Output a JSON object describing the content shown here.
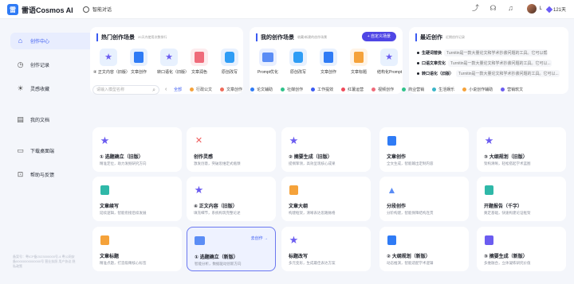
{
  "app": {
    "name": "雷语Cosmos AI",
    "logo_glyph": "雷"
  },
  "topbar": {
    "smart_chat": "智能对话",
    "user_initial": "L",
    "credits": "121天"
  },
  "sidebar": {
    "items": [
      {
        "label": "创作中心",
        "icon": "home-icon"
      },
      {
        "label": "创作记录",
        "icon": "clock-icon"
      },
      {
        "label": "灵感收藏",
        "icon": "bulb-icon"
      },
      {
        "label": "我的文档",
        "icon": "doc-icon"
      },
      {
        "label": "下载桌面端",
        "icon": "monitor-icon"
      },
      {
        "label": "帮助与反馈",
        "icon": "help-icon"
      }
    ],
    "footnote": "备案号：粤ICP备2023000000号-4 粤公网安备00000000000000号 营业执照 用户协议 隐私政策"
  },
  "hot": {
    "title": "热门创作场景",
    "subtitle": "20天内使用次数排行",
    "tiles": [
      {
        "label": "④ 正文内容（旧版）",
        "color": "#6b5cf0"
      },
      {
        "label": "文章创作",
        "color": "#2f7bf5"
      },
      {
        "label": "转口语化（旧版）",
        "color": "#6b5cf0"
      },
      {
        "label": "文章润色",
        "color": "#ef6b7a"
      },
      {
        "label": "原创改写",
        "color": "#2f9df5"
      }
    ]
  },
  "mine": {
    "title": "我的创作场景",
    "subtitle": "收藏/新建的创作场景",
    "custom_button": "+ 自定义场景",
    "tiles": [
      {
        "label": "Prompt优化",
        "color": "#5b8df5"
      },
      {
        "label": "原创改写",
        "color": "#2f9df5"
      },
      {
        "label": "文章创作",
        "color": "#2f7bf5"
      },
      {
        "label": "文章标题",
        "color": "#f5a23a"
      },
      {
        "label": "结构化Prompt",
        "color": "#6b5cf0"
      }
    ]
  },
  "recent": {
    "title": "最近创作",
    "subtitle": "近期创作记录",
    "items": [
      {
        "label": "生硬词替换",
        "text": "Turnitin是一款大量论文和学术抄袭问题的工具。它可以帮助..."
      },
      {
        "label": "口语文章优化",
        "text": "Turnitin是一款大量论文和学术抄袭问题的工具。它可以..."
      },
      {
        "label": "转口语化（旧版）",
        "text": "Turnitin是一款大量论文和学术抄袭问题的工具。它可以..."
      }
    ]
  },
  "search": {
    "placeholder": "请输入模型名称"
  },
  "categories": [
    {
      "label": "全部",
      "color": ""
    },
    {
      "label": "行政公文",
      "color": "#f5a23a"
    },
    {
      "label": "文章创作",
      "color": "#ef6b5a"
    },
    {
      "label": "论文辅助",
      "color": "#2f7bf5"
    },
    {
      "label": "社媒创作",
      "color": "#2fc28a"
    },
    {
      "label": "工作提效",
      "color": "#3b5bf2"
    },
    {
      "label": "红薯运营",
      "color": "#ef4a5a"
    },
    {
      "label": "视频创作",
      "color": "#ef6b7a"
    },
    {
      "label": "商业营销",
      "color": "#2fc28a"
    },
    {
      "label": "生活娱乐",
      "color": "#3bb5c8"
    },
    {
      "label": "小说创作辅助",
      "color": "#f5a23a"
    },
    {
      "label": "营销软文",
      "color": "#6b5cf0"
    }
  ],
  "cards": [
    {
      "title": "① 选题确立（旧版）",
      "desc": "精准定位，助力发掘研究方向",
      "icon": "star",
      "color": "#6b5cf0"
    },
    {
      "title": "创作灵感",
      "desc": "激发创意，突破思维定式瓶颈",
      "icon": "spark",
      "color": "#ef5a5a"
    },
    {
      "title": "② 摘要生成（旧版）",
      "desc": "提纲挈领，高效呈现核心成果",
      "icon": "star",
      "color": "#6b5cf0"
    },
    {
      "title": "文章创作",
      "desc": "全文生成，智能输出定制内容",
      "icon": "doc",
      "color": "#2f7bf5"
    },
    {
      "title": "③ 大纲规划（旧版）",
      "desc": "架构清晰，轻松搭起学术蓝图",
      "icon": "star",
      "color": "#6b5cf0"
    },
    {
      "title": "文章续写",
      "desc": "延续逻辑，智能衔接后续发展",
      "icon": "doc",
      "color": "#2fb8a8"
    },
    {
      "title": "④ 正文内容（旧版）",
      "desc": "填充细节，系统构筑完整论述",
      "icon": "star",
      "color": "#6b5cf0"
    },
    {
      "title": "文章大纲",
      "desc": "构建框架，清晰表达思路脉络",
      "icon": "doc",
      "color": "#f5a23a"
    },
    {
      "title": "分段创作",
      "desc": "分阶构建，智能保障结构连贯",
      "icon": "tri",
      "color": "#5b8df5"
    },
    {
      "title": "开题报告（千字）",
      "desc": "奠定基础，快速构建论证框架",
      "icon": "doc",
      "color": "#2fb8a8"
    },
    {
      "title": "文章标题",
      "desc": "精准点题，打造吸睛核心标签",
      "icon": "doc",
      "color": "#f5a23a"
    },
    {
      "title": "① 选题确立（新版）",
      "desc": "智能分析，数据驱动创新方向",
      "icon": "screen",
      "color": "#5b8df5",
      "link": "去创作 →"
    },
    {
      "title": "标题改写",
      "desc": "多元变形，生成最佳表达方案",
      "icon": "star",
      "color": "#6b5cf0"
    },
    {
      "title": "② 大纲规划（新版）",
      "desc": "动态推演，智能适配学术逻辑",
      "icon": "doc",
      "color": "#2f7bf5"
    },
    {
      "title": "③ 摘要生成（新版）",
      "desc": "多维融合，立体凝练研究价值",
      "icon": "doc",
      "color": "#6b5cf0"
    }
  ]
}
